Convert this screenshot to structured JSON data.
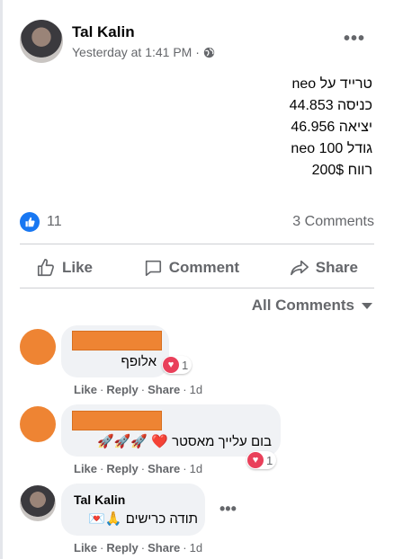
{
  "post": {
    "author": "Tal Kalin",
    "timestamp": "Yesterday at 1:41 PM ·",
    "more": "•••",
    "lines": [
      "טרייד על neo",
      "כניסה 44.853",
      "יציאה 46.956",
      "גודל 100 neo",
      "רווח 200$"
    ],
    "reaction_count": "11",
    "comments_count": "3 Comments"
  },
  "actions": {
    "like": "Like",
    "comment": "Comment",
    "share": "Share"
  },
  "comments_filter": "All Comments",
  "comment_action_labels": {
    "like": "Like",
    "reply": "Reply",
    "share": "Share"
  },
  "comments": [
    {
      "text": "אלופף",
      "reaction_count": "1",
      "time": "1d"
    },
    {
      "text": "בום עלייך מאסטר ❤️ 🚀🚀🚀",
      "reaction_count": "1",
      "time": "1d"
    },
    {
      "author": "Tal Kalin",
      "text": "תודה כרישים 🙏💌",
      "time": "1d"
    }
  ],
  "icons": [
    "globe-icon",
    "thumbs-up-icon",
    "like-reaction-icon",
    "comment-icon",
    "share-icon",
    "love-reaction-icon",
    "chevron-down-icon"
  ],
  "colors": {
    "brand": "#1877f2",
    "love": "#e9405a",
    "redaction": "#ee8433"
  }
}
